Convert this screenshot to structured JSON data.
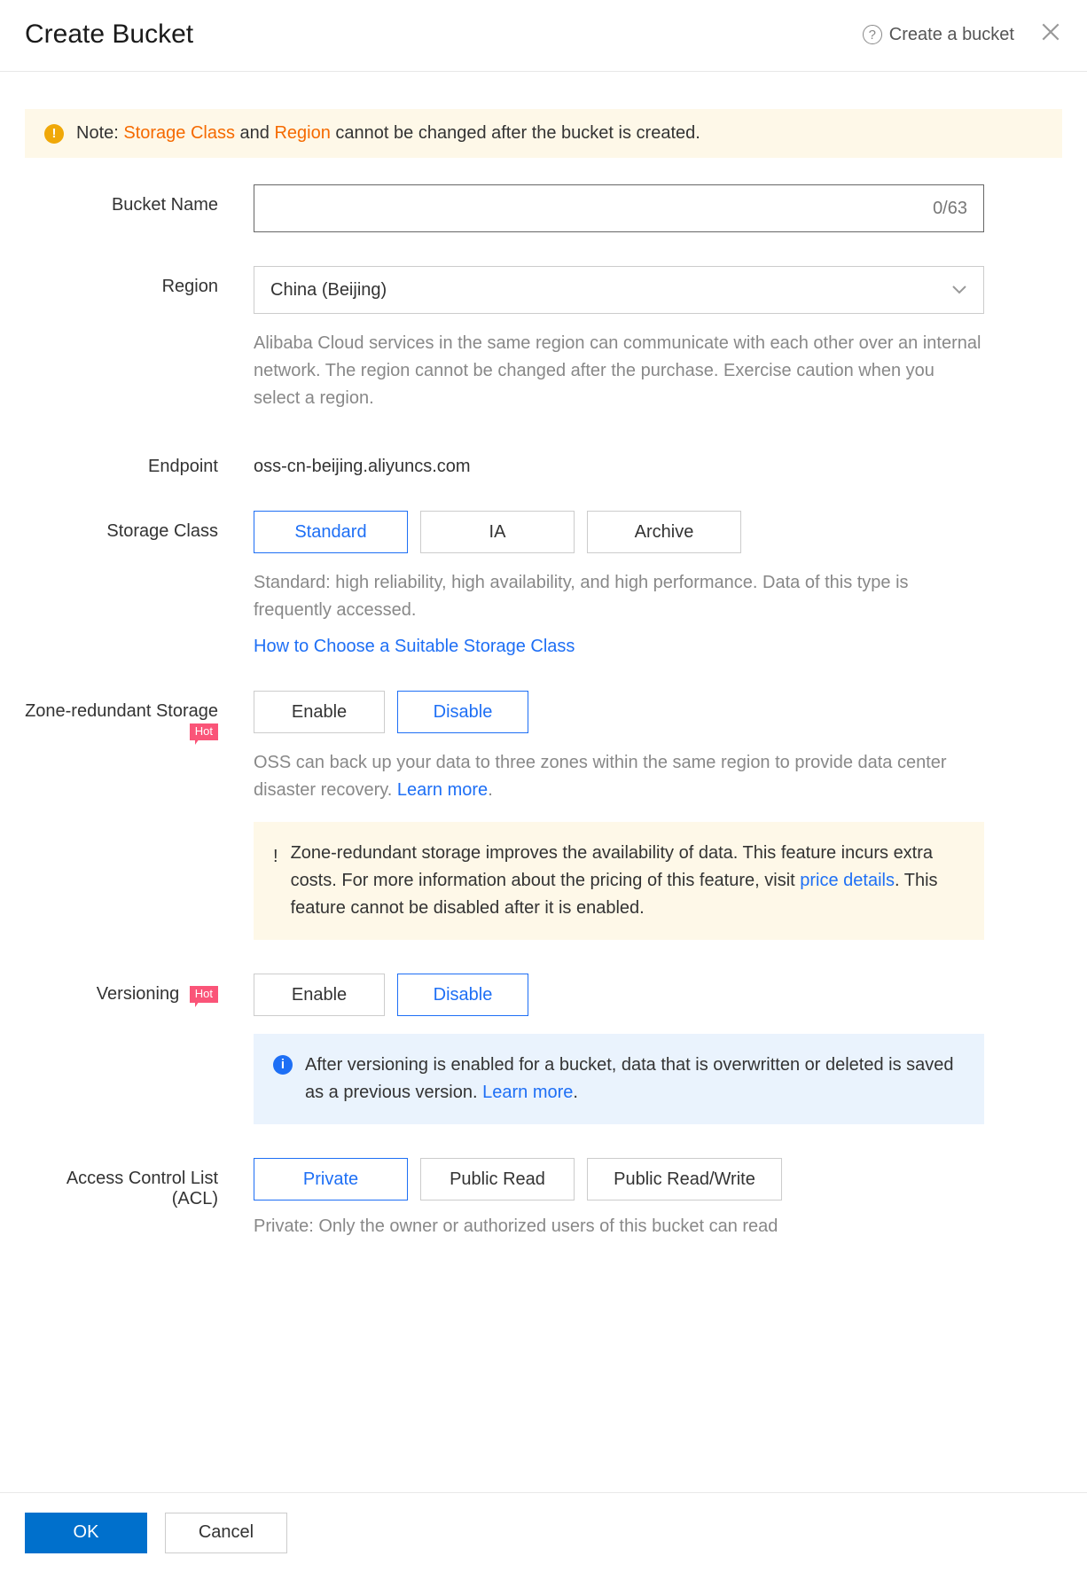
{
  "header": {
    "title": "Create Bucket",
    "help_link": "Create a bucket"
  },
  "notice": {
    "prefix": "Note: ",
    "storage_class": "Storage Class",
    "and": " and ",
    "region": "Region",
    "suffix": " cannot be changed after the bucket is created."
  },
  "bucket_name": {
    "label": "Bucket Name",
    "value": "",
    "counter": "0/63"
  },
  "region": {
    "label": "Region",
    "selected": "China (Beijing)",
    "help": "Alibaba Cloud services in the same region can communicate with each other over an internal network. The region cannot be changed after the purchase. Exercise caution when you select a region."
  },
  "endpoint": {
    "label": "Endpoint",
    "value": "oss-cn-beijing.aliyuncs.com"
  },
  "storage_class": {
    "label": "Storage Class",
    "options": [
      "Standard",
      "IA",
      "Archive"
    ],
    "help": "Standard: high reliability, high availability, and high performance. Data of this type is frequently accessed.",
    "link": "How to Choose a Suitable Storage Class"
  },
  "zrs": {
    "label": "Zone-redundant Storage",
    "badge": "Hot",
    "options": [
      "Enable",
      "Disable"
    ],
    "help_pre": "OSS can back up your data to three zones within the same region to provide data center disaster recovery. ",
    "learn_more": "Learn more",
    "help_post": ".",
    "notice_pre": "Zone-redundant storage improves the availability of data. This feature incurs extra costs. For more information about the pricing of this feature, visit ",
    "price_link": "price details",
    "notice_post": ". This feature cannot be disabled after it is enabled."
  },
  "versioning": {
    "label": "Versioning",
    "badge": "Hot",
    "options": [
      "Enable",
      "Disable"
    ],
    "notice_pre": "After versioning is enabled for a bucket, data that is overwritten or deleted is saved as a previous version. ",
    "learn_more": "Learn more",
    "notice_post": "."
  },
  "acl": {
    "label": "Access Control List (ACL)",
    "options": [
      "Private",
      "Public Read",
      "Public Read/Write"
    ],
    "help": "Private: Only the owner or authorized users of this bucket can read"
  },
  "footer": {
    "ok": "OK",
    "cancel": "Cancel"
  }
}
